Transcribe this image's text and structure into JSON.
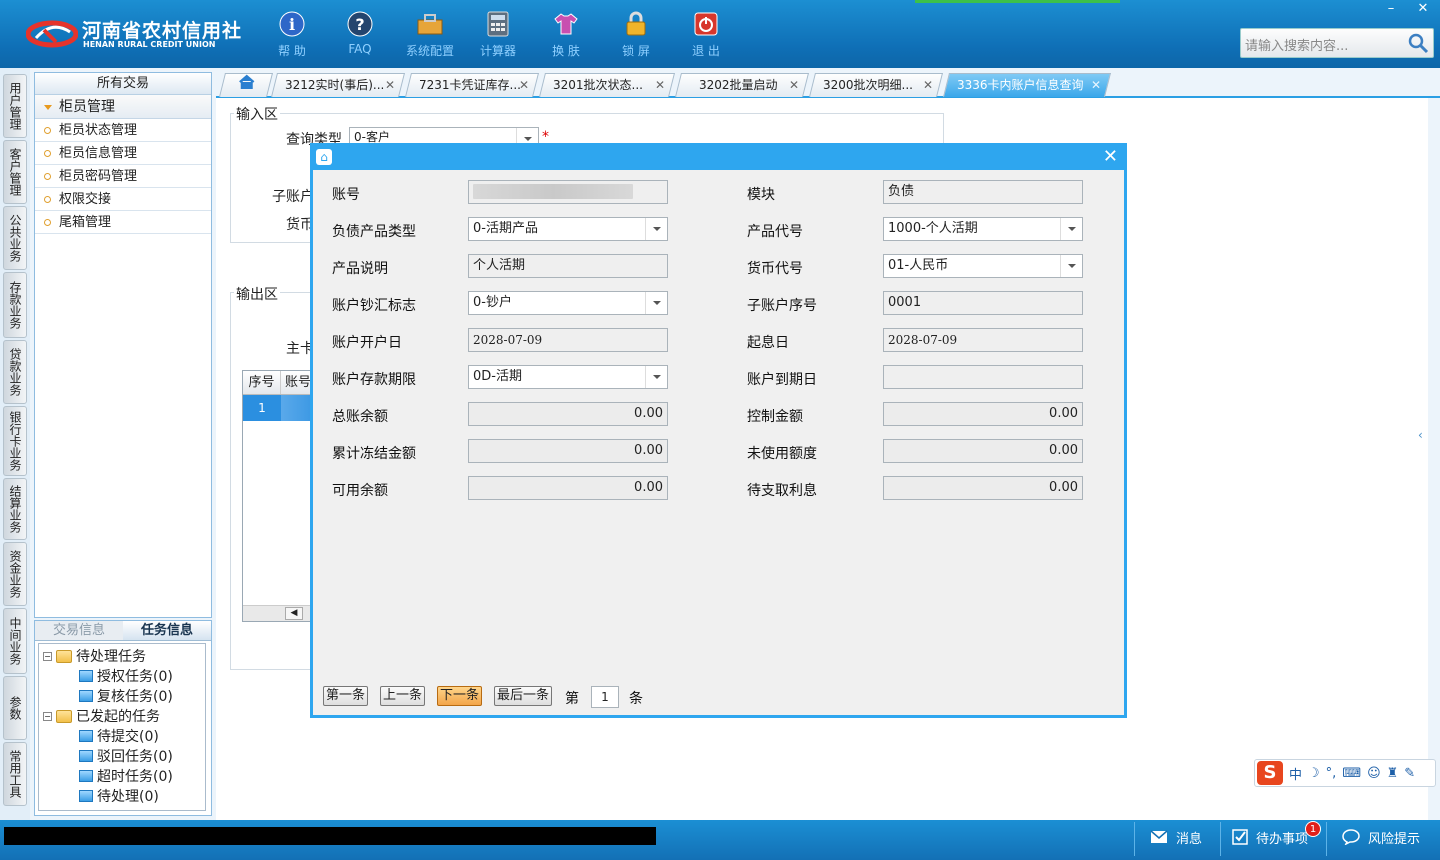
{
  "header": {
    "logo_cn": "河南省农村信用社",
    "logo_en": "HENAN RURAL CREDIT UNION",
    "toolbar": [
      {
        "label": "帮 助",
        "icon": "info-icon"
      },
      {
        "label": "FAQ",
        "icon": "question-icon"
      },
      {
        "label": "系统配置",
        "icon": "toolbox-icon"
      },
      {
        "label": "计算器",
        "icon": "calculator-icon"
      },
      {
        "label": "换 肤",
        "icon": "shirt-icon"
      },
      {
        "label": "锁 屏",
        "icon": "lock-icon"
      },
      {
        "label": "退 出",
        "icon": "power-icon"
      }
    ],
    "search_placeholder": "请输入搜索内容...",
    "minimize": "–",
    "close": "✕"
  },
  "rail": [
    "用户管理",
    "客户管理",
    "公共业务",
    "存款业务",
    "贷款业务",
    "银行卡业务",
    "结算业务",
    "资金业务",
    "中间业务",
    "参数",
    "常用工具"
  ],
  "tree": {
    "title": "所有交易",
    "group": "柜员管理",
    "items": [
      "柜员状态管理",
      "柜员信息管理",
      "柜员密码管理",
      "权限交接",
      "尾箱管理"
    ]
  },
  "tasks": {
    "tab_trade": "交易信息",
    "tab_task": "任务信息",
    "pending_group": "待处理任务",
    "pending": [
      "授权任务(0)",
      "复核任务(0)"
    ],
    "initiated_group": "已发起的任务",
    "initiated": [
      "待提交(0)",
      "驳回任务(0)",
      "超时任务(0)",
      "待处理(0)"
    ]
  },
  "tabs": [
    {
      "label": "3212实时(事后)..."
    },
    {
      "label": "7231卡凭证库存..."
    },
    {
      "label": "3201批次状态..."
    },
    {
      "label": "3202批量启动"
    },
    {
      "label": "3200批次明细..."
    },
    {
      "label": "3336卡内账户信息查询"
    }
  ],
  "page": {
    "input_area": "输入区",
    "query_type_label": "查询类型",
    "query_type_value": "0-客户",
    "required_mark": "*",
    "subaccount_label": "子账户",
    "currency_label": "货币",
    "output_area": "输出区",
    "main_label": "主卡",
    "col_seq": "序号",
    "col_acct": "账号",
    "row_seq": "1"
  },
  "modal": {
    "fields_left": [
      {
        "label": "账号",
        "value": "████████████████",
        "type": "blur"
      },
      {
        "label": "负债产品类型",
        "value": "0-活期产品",
        "type": "select"
      },
      {
        "label": "产品说明",
        "value": "个人活期",
        "type": "text"
      },
      {
        "label": "账户钞汇标志",
        "value": "0-钞户",
        "type": "select"
      },
      {
        "label": "账户开户日",
        "value": "2028-07-09",
        "type": "text"
      },
      {
        "label": "账户存款期限",
        "value": "0D-活期",
        "type": "select"
      },
      {
        "label": "总账余额",
        "value": "0.00",
        "type": "num"
      },
      {
        "label": "累计冻结金额",
        "value": "0.00",
        "type": "num"
      },
      {
        "label": "可用余额",
        "value": "0.00",
        "type": "num"
      }
    ],
    "fields_right": [
      {
        "label": "模块",
        "value": "负债",
        "type": "text"
      },
      {
        "label": "产品代号",
        "value": "1000-个人活期",
        "type": "select"
      },
      {
        "label": "货币代号",
        "value": "01-人民币",
        "type": "select"
      },
      {
        "label": "子账户序号",
        "value": "0001",
        "type": "text"
      },
      {
        "label": "起息日",
        "value": "2028-07-09",
        "type": "text"
      },
      {
        "label": "账户到期日",
        "value": "",
        "type": "text"
      },
      {
        "label": "控制金额",
        "value": "0.00",
        "type": "num"
      },
      {
        "label": "未使用额度",
        "value": "0.00",
        "type": "num"
      },
      {
        "label": "待支取利息",
        "value": "0.00",
        "type": "num"
      }
    ],
    "pager": {
      "first": "第一条",
      "prev": "上一条",
      "next": "下一条",
      "last": "最后一条",
      "page_prefix": "第",
      "page_value": "1",
      "page_suffix": "条"
    }
  },
  "statusbar": {
    "message": "消息",
    "todo": "待办事项",
    "todo_badge": "1",
    "risk": "风险提示"
  },
  "ime": {
    "lang": "中"
  },
  "colors": {
    "header": "#1c8fd2",
    "accent": "#2ea6ef",
    "highlight": "#f3a54a"
  }
}
